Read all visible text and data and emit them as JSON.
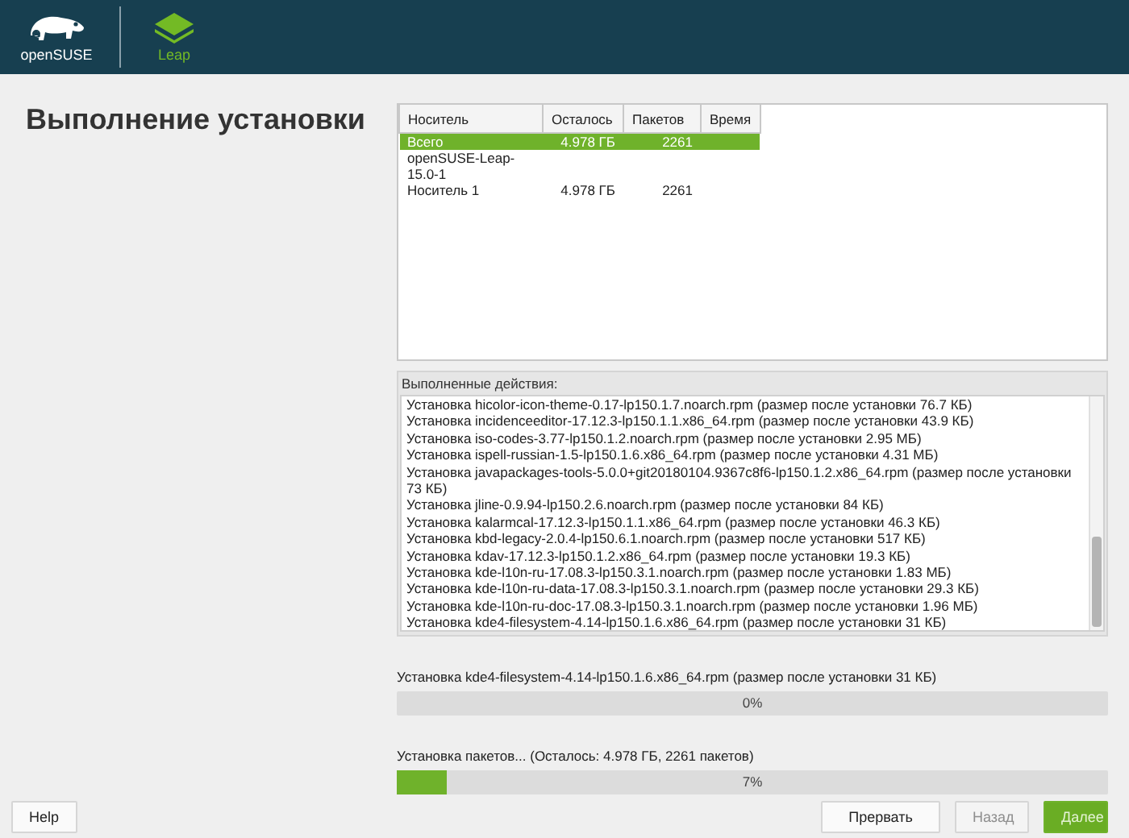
{
  "header": {
    "brand": "openSUSE",
    "product": "Leap"
  },
  "title": "Выполнение установки",
  "media_table": {
    "columns": [
      "Носитель",
      "Осталось",
      "Пакетов",
      "Время"
    ],
    "rows": [
      {
        "name": "Всего",
        "remaining": "4.978 ГБ",
        "packages": "2261",
        "selected": true
      },
      {
        "name": "openSUSE-Leap-15.0-1\nНоситель 1",
        "remaining": "4.978 ГБ",
        "packages": "2261",
        "selected": false
      }
    ]
  },
  "log": {
    "label": "Выполненные действия:",
    "lines": [
      "Установка hicolor-icon-theme-0.17-lp150.1.7.noarch.rpm (размер после установки 76.7 КБ)",
      "Установка incidenceeditor-17.12.3-lp150.1.1.x86_64.rpm (размер после установки 43.9 КБ)",
      "Установка iso-codes-3.77-lp150.1.2.noarch.rpm (размер после установки 2.95 МБ)",
      "Установка ispell-russian-1.5-lp150.1.6.x86_64.rpm (размер после установки 4.31 МБ)",
      "Установка javapackages-tools-5.0.0+git20180104.9367c8f6-lp150.1.2.x86_64.rpm (размер после установки 73 КБ)",
      "Установка jline-0.9.94-lp150.2.6.noarch.rpm (размер после установки 84 КБ)",
      "Установка kalarmcal-17.12.3-lp150.1.1.x86_64.rpm (размер после установки 46.3 КБ)",
      "Установка kbd-legacy-2.0.4-lp150.6.1.noarch.rpm (размер после установки 517 КБ)",
      "Установка kdav-17.12.3-lp150.1.2.x86_64.rpm (размер после установки 19.3 КБ)",
      "Установка kde-l10n-ru-17.08.3-lp150.3.1.noarch.rpm (размер после установки 1.83 МБ)",
      "Установка kde-l10n-ru-data-17.08.3-lp150.3.1.noarch.rpm (размер после установки 29.3 КБ)",
      "Установка kde-l10n-ru-doc-17.08.3-lp150.3.1.noarch.rpm (размер после установки 1.96 МБ)",
      "Установка kde4-filesystem-4.14-lp150.1.6.x86_64.rpm (размер после установки 31 КБ)"
    ]
  },
  "progress": [
    {
      "label": "Установка kde4-filesystem-4.14-lp150.1.6.x86_64.rpm (размер после установки 31 КБ)",
      "level": 0,
      "reading": "0%"
    },
    {
      "label": "Установка пакетов... (Осталось: 4.978 ГБ, 2261 пакетов)",
      "level": 0.07,
      "reading": "7%"
    }
  ],
  "buttons": [
    {
      "label": "Help",
      "kind": "plain",
      "disabled": false
    },
    {
      "label": "Прервать",
      "kind": "plain",
      "disabled": false
    },
    {
      "label": "Назад",
      "kind": "plain",
      "disabled": true
    },
    {
      "label": "Далее",
      "kind": "primary",
      "disabled": true
    }
  ]
}
